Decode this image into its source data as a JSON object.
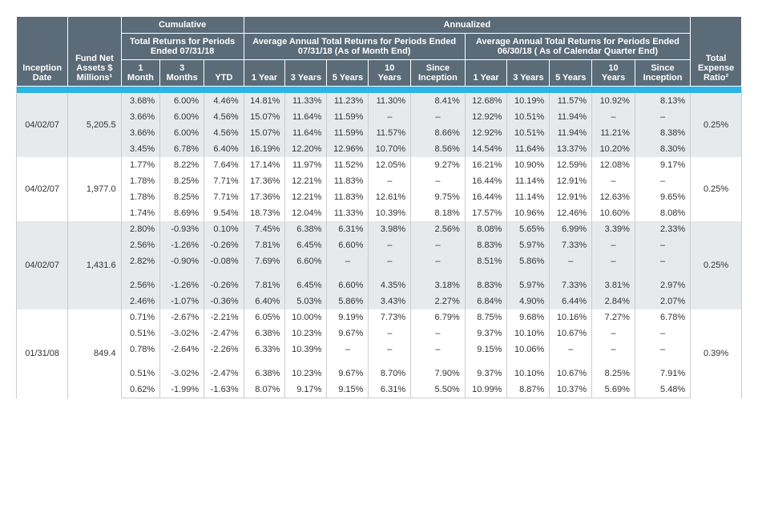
{
  "headers": {
    "inception_date": "Inception Date",
    "fund_net_assets": "Fund Net Assets $ Millions¹",
    "cumulative": "Cumulative",
    "cumulative_sub": "Total Returns for Periods Ended 07/31/18",
    "annualized": "Annualized",
    "annualized_sub1": "Average Annual Total Returns for Periods Ended 07/31/18 (As of Month End)",
    "annualized_sub2": "Average Annual Total Returns for Periods Ended 06/30/18 ( As of Calendar Quarter End)",
    "total_expense_ratio": "Total Expense Ratio²",
    "c1": "1 Month",
    "c2": "3 Months",
    "c3": "YTD",
    "a1": "1 Year",
    "a2": "3 Years",
    "a3": "5 Years",
    "a4": "10 Years",
    "a5": "Since Inception"
  },
  "dash": "–",
  "groups": [
    {
      "inception_date": "04/02/07",
      "fund_net_assets": "5,205.5",
      "expense_ratio": "0.25%",
      "class": "group-1",
      "rows": [
        {
          "m1": "3.68%",
          "m3": "6.00%",
          "ytd": "4.46%",
          "y1": "14.81%",
          "y3": "11.33%",
          "y5": "11.23%",
          "y10": "11.30%",
          "si": "8.41%",
          "q1": "12.68%",
          "q3": "10.19%",
          "q5": "11.57%",
          "q10": "10.92%",
          "qsi": "8.13%"
        },
        {
          "m1": "3.66%",
          "m3": "6.00%",
          "ytd": "4.56%",
          "y1": "15.07%",
          "y3": "11.64%",
          "y5": "11.59%",
          "y10": "–",
          "si": "–",
          "q1": "12.92%",
          "q3": "10.51%",
          "q5": "11.94%",
          "q10": "–",
          "qsi": "–"
        },
        {
          "m1": "3.66%",
          "m3": "6.00%",
          "ytd": "4.56%",
          "y1": "15.07%",
          "y3": "11.64%",
          "y5": "11.59%",
          "y10": "11.57%",
          "si": "8.66%",
          "q1": "12.92%",
          "q3": "10.51%",
          "q5": "11.94%",
          "q10": "11.21%",
          "qsi": "8.38%"
        },
        {
          "m1": "3.45%",
          "m3": "6.78%",
          "ytd": "6.40%",
          "y1": "16.19%",
          "y3": "12.20%",
          "y5": "12.96%",
          "y10": "10.70%",
          "si": "8.56%",
          "q1": "14.54%",
          "q3": "11.64%",
          "q5": "13.37%",
          "q10": "10.20%",
          "qsi": "8.30%"
        }
      ]
    },
    {
      "inception_date": "04/02/07",
      "fund_net_assets": "1,977.0",
      "expense_ratio": "0.25%",
      "class": "group-2",
      "rows": [
        {
          "m1": "1.77%",
          "m3": "8.22%",
          "ytd": "7.64%",
          "y1": "17.14%",
          "y3": "11.97%",
          "y5": "11.52%",
          "y10": "12.05%",
          "si": "9.27%",
          "q1": "16.21%",
          "q3": "10.90%",
          "q5": "12.59%",
          "q10": "12.08%",
          "qsi": "9.17%"
        },
        {
          "m1": "1.78%",
          "m3": "8.25%",
          "ytd": "7.71%",
          "y1": "17.36%",
          "y3": "12.21%",
          "y5": "11.83%",
          "y10": "–",
          "si": "–",
          "q1": "16.44%",
          "q3": "11.14%",
          "q5": "12.91%",
          "q10": "–",
          "qsi": "–"
        },
        {
          "m1": "1.78%",
          "m3": "8.25%",
          "ytd": "7.71%",
          "y1": "17.36%",
          "y3": "12.21%",
          "y5": "11.83%",
          "y10": "12.61%",
          "si": "9.75%",
          "q1": "16.44%",
          "q3": "11.14%",
          "q5": "12.91%",
          "q10": "12.63%",
          "qsi": "9.65%"
        },
        {
          "m1": "1.74%",
          "m3": "8.69%",
          "ytd": "9.54%",
          "y1": "18.73%",
          "y3": "12.04%",
          "y5": "11.33%",
          "y10": "10.39%",
          "si": "8.18%",
          "q1": "17.57%",
          "q3": "10.96%",
          "q5": "12.46%",
          "q10": "10.60%",
          "qsi": "8.08%"
        }
      ]
    },
    {
      "inception_date": "04/02/07",
      "fund_net_assets": "1,431.6",
      "expense_ratio": "0.25%",
      "class": "group-3",
      "gap_after": 3,
      "rows": [
        {
          "m1": "2.80%",
          "m3": "-0.93%",
          "ytd": "0.10%",
          "y1": "7.45%",
          "y3": "6.38%",
          "y5": "6.31%",
          "y10": "3.98%",
          "si": "2.56%",
          "q1": "8.08%",
          "q3": "5.65%",
          "q5": "6.99%",
          "q10": "3.39%",
          "qsi": "2.33%"
        },
        {
          "m1": "2.56%",
          "m3": "-1.26%",
          "ytd": "-0.26%",
          "y1": "7.81%",
          "y3": "6.45%",
          "y5": "6.60%",
          "y10": "–",
          "si": "–",
          "q1": "8.83%",
          "q3": "5.97%",
          "q5": "7.33%",
          "q10": "–",
          "qsi": "–"
        },
        {
          "m1": "2.82%",
          "m3": "-0.90%",
          "ytd": "-0.08%",
          "y1": "7.69%",
          "y3": "6.60%",
          "y5": "–",
          "y10": "–",
          "si": "–",
          "q1": "8.51%",
          "q3": "5.86%",
          "q5": "–",
          "q10": "–",
          "qsi": "–"
        },
        {
          "m1": "2.56%",
          "m3": "-1.26%",
          "ytd": "-0.26%",
          "y1": "7.81%",
          "y3": "6.45%",
          "y5": "6.60%",
          "y10": "4.35%",
          "si": "3.18%",
          "q1": "8.83%",
          "q3": "5.97%",
          "q5": "7.33%",
          "q10": "3.81%",
          "qsi": "2.97%"
        },
        {
          "m1": "2.46%",
          "m3": "-1.07%",
          "ytd": "-0.36%",
          "y1": "6.40%",
          "y3": "5.03%",
          "y5": "5.86%",
          "y10": "3.43%",
          "si": "2.27%",
          "q1": "6.84%",
          "q3": "4.90%",
          "q5": "6.44%",
          "q10": "2.84%",
          "qsi": "2.07%"
        }
      ]
    },
    {
      "inception_date": "01/31/08",
      "fund_net_assets": "849.4",
      "expense_ratio": "0.39%",
      "class": "group-4",
      "gap_after": 3,
      "last": true,
      "rows": [
        {
          "m1": "0.71%",
          "m3": "-2.67%",
          "ytd": "-2.21%",
          "y1": "6.05%",
          "y3": "10.00%",
          "y5": "9.19%",
          "y10": "7.73%",
          "si": "6.79%",
          "q1": "8.75%",
          "q3": "9.68%",
          "q5": "10.16%",
          "q10": "7.27%",
          "qsi": "6.78%"
        },
        {
          "m1": "0.51%",
          "m3": "-3.02%",
          "ytd": "-2.47%",
          "y1": "6.38%",
          "y3": "10.23%",
          "y5": "9.67%",
          "y10": "–",
          "si": "–",
          "q1": "9.37%",
          "q3": "10.10%",
          "q5": "10.67%",
          "q10": "–",
          "qsi": "–"
        },
        {
          "m1": "0.78%",
          "m3": "-2.64%",
          "ytd": "-2.26%",
          "y1": "6.33%",
          "y3": "10.39%",
          "y5": "–",
          "y10": "–",
          "si": "–",
          "q1": "9.15%",
          "q3": "10.06%",
          "q5": "–",
          "q10": "–",
          "qsi": "–"
        },
        {
          "m1": "0.51%",
          "m3": "-3.02%",
          "ytd": "-2.47%",
          "y1": "6.38%",
          "y3": "10.23%",
          "y5": "9.67%",
          "y10": "8.70%",
          "si": "7.90%",
          "q1": "9.37%",
          "q3": "10.10%",
          "q5": "10.67%",
          "q10": "8.25%",
          "qsi": "7.91%"
        },
        {
          "m1": "0.62%",
          "m3": "-1.99%",
          "ytd": "-1.63%",
          "y1": "8.07%",
          "y3": "9.17%",
          "y5": "9.15%",
          "y10": "6.31%",
          "si": "5.50%",
          "q1": "10.99%",
          "q3": "8.87%",
          "q5": "10.37%",
          "q10": "5.69%",
          "qsi": "5.48%"
        }
      ]
    }
  ]
}
